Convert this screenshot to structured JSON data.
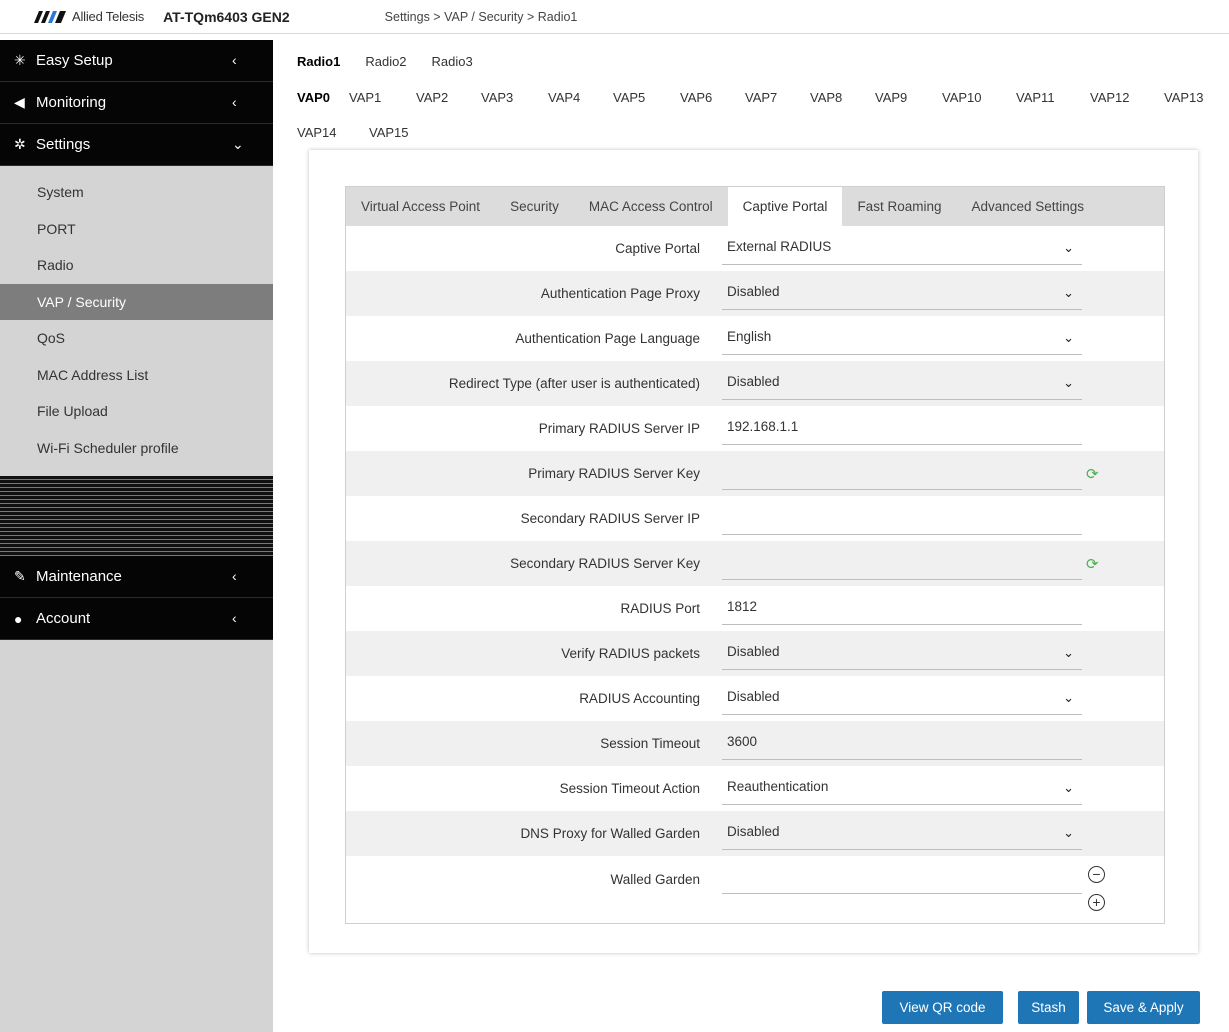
{
  "header": {
    "brand": "Allied Telesis",
    "model": "AT-TQm6403 GEN2",
    "breadcrumb": "Settings > VAP / Security > Radio1"
  },
  "sidebar": {
    "main_items": [
      {
        "label": "Easy Setup",
        "icon": "magic-wand-icon"
      },
      {
        "label": "Monitoring",
        "icon": "share-icon"
      },
      {
        "label": "Settings",
        "icon": "gear-icon"
      }
    ],
    "settings_items": [
      "System",
      "PORT",
      "Radio",
      "VAP / Security",
      "QoS",
      "MAC Address List",
      "File Upload",
      "Wi-Fi Scheduler profile"
    ],
    "active_item": "VAP / Security",
    "bottom_items": [
      {
        "label": "Maintenance",
        "icon": "wrench-icon"
      },
      {
        "label": "Account",
        "icon": "user-icon"
      }
    ]
  },
  "radio_tabs": [
    "Radio1",
    "Radio2",
    "Radio3"
  ],
  "vap_tabs": [
    "VAP0",
    "VAP1",
    "VAP2",
    "VAP3",
    "VAP4",
    "VAP5",
    "VAP6",
    "VAP7",
    "VAP8",
    "VAP9",
    "VAP10",
    "VAP11",
    "VAP12",
    "VAP13",
    "VAP14",
    "VAP15"
  ],
  "sub_tabs": [
    "Virtual Access Point",
    "Security",
    "MAC Access Control",
    "Captive Portal",
    "Fast Roaming",
    "Advanced Settings"
  ],
  "form": [
    {
      "label": "Captive Portal",
      "value": "External RADIUS",
      "type": "select"
    },
    {
      "label": "Authentication Page Proxy",
      "value": "Disabled",
      "type": "select"
    },
    {
      "label": "Authentication Page Language",
      "value": "English",
      "type": "select"
    },
    {
      "label": "Redirect Type (after user is authenticated)",
      "value": "Disabled",
      "type": "select"
    },
    {
      "label": "Primary RADIUS Server IP",
      "value": "192.168.1.1",
      "type": "input"
    },
    {
      "label": "Primary RADIUS Server Key",
      "value": "",
      "type": "input"
    },
    {
      "label": "Secondary RADIUS Server IP",
      "value": "",
      "type": "input"
    },
    {
      "label": "Secondary RADIUS Server Key",
      "value": "",
      "type": "input"
    },
    {
      "label": "RADIUS Port",
      "value": "1812",
      "type": "input"
    },
    {
      "label": "Verify RADIUS packets",
      "value": "Disabled",
      "type": "select"
    },
    {
      "label": "RADIUS Accounting",
      "value": "Disabled",
      "type": "select"
    },
    {
      "label": "Session Timeout",
      "value": "3600",
      "type": "input"
    },
    {
      "label": "Session Timeout Action",
      "value": "Reauthentication",
      "type": "select"
    },
    {
      "label": "DNS Proxy for Walled Garden",
      "value": "Disabled",
      "type": "select"
    },
    {
      "label": "Walled Garden",
      "value": "",
      "type": "input"
    }
  ],
  "buttons": {
    "qr": "View QR code",
    "stash": "Stash",
    "apply": "Save & Apply"
  },
  "colors": {
    "accent": "#1f76b6",
    "sidebar_dark": "#050505",
    "sidebar_light": "#d4d4d4",
    "active_item": "#7d7d7d"
  }
}
